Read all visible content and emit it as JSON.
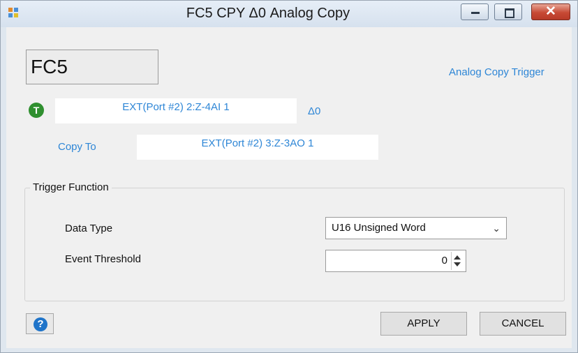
{
  "window": {
    "title": "FC5 CPY Δ0 Analog Copy"
  },
  "dialog": {
    "function_code": "FC5",
    "trigger_link": "Analog Copy Trigger",
    "source_value": "EXT(Port #2) 2:Z-4AI 1",
    "delta_label": "Δ0",
    "copy_to_label": "Copy To",
    "destination_value": "EXT(Port #2) 3:Z-3AO 1"
  },
  "trigger_function": {
    "legend": "Trigger Function",
    "data_type_label": "Data Type",
    "data_type_value": "U16 Unsigned Word",
    "event_threshold_label": "Event Threshold",
    "event_threshold_value": "0"
  },
  "footer": {
    "apply_label": "APPLY",
    "cancel_label": "CANCEL"
  },
  "icons": {
    "app": "app-icon",
    "trigger": "trigger-t-icon",
    "help": "help-icon"
  },
  "colors": {
    "accent_blue": "#2e86d6",
    "trigger_green": "#2f8f2f",
    "close_red": "#c74a35"
  }
}
